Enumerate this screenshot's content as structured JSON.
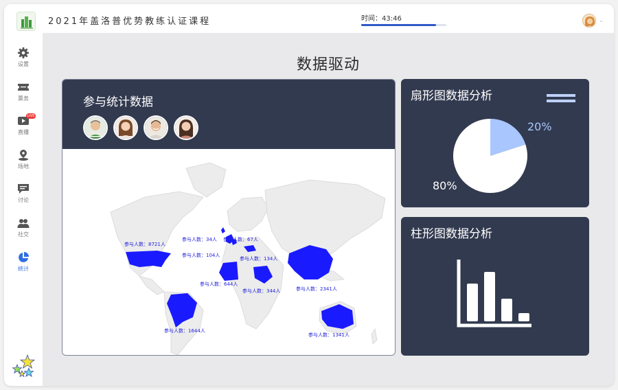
{
  "header": {
    "course_title": "2021年盖洛普优势教练认证课程",
    "timer_text": "时间：43:46",
    "timer_progress": 0.88,
    "user_avatar_icon": "user-avatar-icon"
  },
  "sidebar": {
    "items": [
      {
        "label": "设置",
        "icon": "gear-icon"
      },
      {
        "label": "票务",
        "icon": "ticket-icon"
      },
      {
        "label": "直播",
        "icon": "live-video-icon",
        "badge": "LIVE"
      },
      {
        "label": "场地",
        "icon": "location-icon"
      },
      {
        "label": "讨论",
        "icon": "chat-icon"
      },
      {
        "label": "社交",
        "icon": "people-icon"
      },
      {
        "label": "统计",
        "icon": "pie-chart-icon",
        "active": true
      }
    ],
    "bottom_icon": "stars-icon"
  },
  "main": {
    "title": "数据驱动"
  },
  "participants_card": {
    "title": "参与统计数据",
    "map_labels": [
      "参与人数：8721人",
      "参与人数：34人",
      "参与人数：67人",
      "参与人数：104人",
      "参与人数：134人",
      "参与人数：644人",
      "参与人数：344人",
      "参与人数：2341人",
      "参与人数：1644人",
      "参与人数：1341人"
    ]
  },
  "pie_card": {
    "title": "扇形图数据分析",
    "slices": [
      {
        "label": "20%",
        "value": 20,
        "color": "#a9c6ff"
      },
      {
        "label": "80%",
        "value": 80,
        "color": "#ffffff"
      }
    ]
  },
  "bar_card": {
    "title": "柱形图数据分析",
    "bars": [
      0.55,
      0.72,
      0.33,
      0.12
    ]
  },
  "colors": {
    "card_dark": "#323a4f",
    "accent_blue": "#2f58c9",
    "map_highlight": "#1a1aff"
  }
}
